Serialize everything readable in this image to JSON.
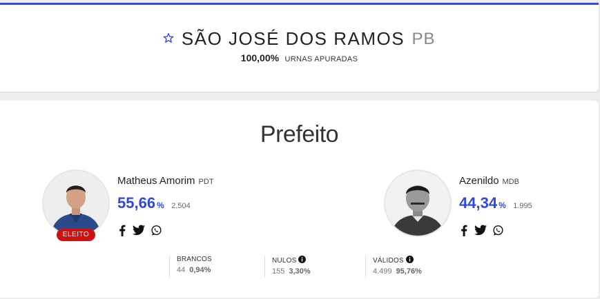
{
  "header": {
    "city": "SÃO JOSÉ DOS RAMOS",
    "state": "PB",
    "progress_value": "100,00%",
    "progress_label": "URNAS APURADAS"
  },
  "office": "Prefeito",
  "candidates": [
    {
      "name": "Matheus Amorim",
      "party": "PDT",
      "percent": "55,66",
      "percent_sign": "%",
      "votes": "2.504",
      "badge": "ELEITO"
    },
    {
      "name": "Azenildo",
      "party": "MDB",
      "percent": "44,34",
      "percent_sign": "%",
      "votes": "1.995"
    }
  ],
  "stats": [
    {
      "label": "BRANCOS",
      "count": "44",
      "percent": "0,94%"
    },
    {
      "label": "NULOS",
      "count": "155",
      "percent": "3,30%"
    },
    {
      "label": "VÁLIDOS",
      "count": "4.499",
      "percent": "95,76%"
    }
  ],
  "colors": {
    "accent": "#3047d8",
    "elected": "#cc1111",
    "top_border": "#3b4cc9"
  },
  "icons": [
    "star-icon",
    "facebook-icon",
    "twitter-icon",
    "whatsapp-icon",
    "info-icon"
  ]
}
